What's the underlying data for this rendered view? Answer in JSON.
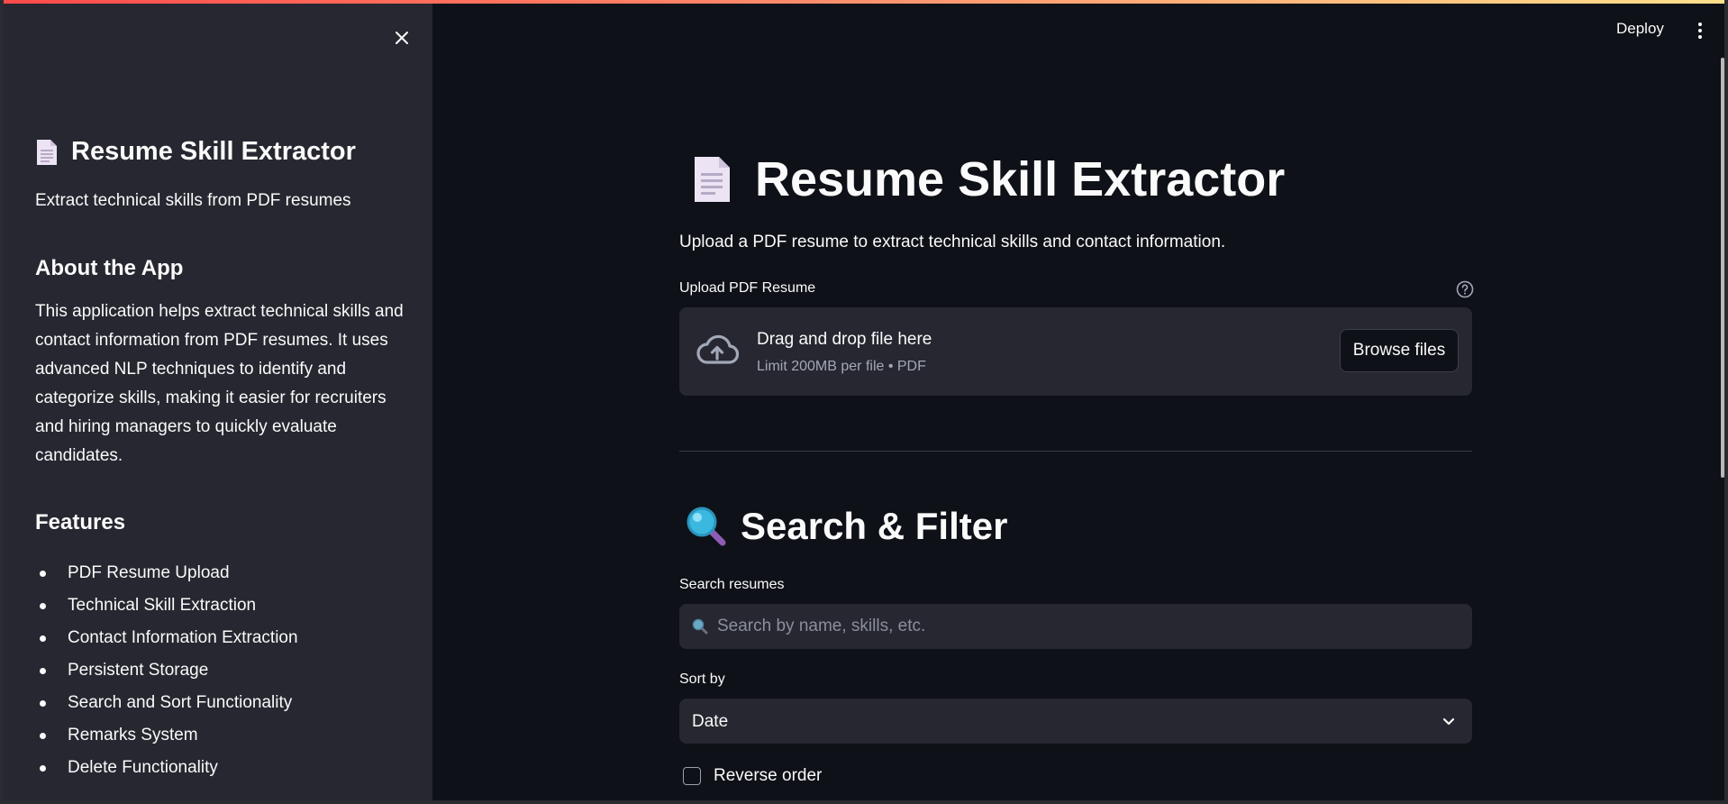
{
  "header": {
    "deploy_label": "Deploy"
  },
  "sidebar": {
    "title": "Resume Skill Extractor",
    "subtitle": "Extract technical skills from PDF resumes",
    "about_heading": "About the App",
    "about_text": "This application helps extract technical skills and contact information from PDF resumes. It uses advanced NLP techniques to identify and categorize skills, making it easier for recruiters and hiring managers to quickly evaluate candidates.",
    "features_heading": "Features",
    "features": [
      "PDF Resume Upload",
      "Technical Skill Extraction",
      "Contact Information Extraction",
      "Persistent Storage",
      "Search and Sort Functionality",
      "Remarks System",
      "Delete Functionality"
    ]
  },
  "main": {
    "title": "Resume Skill Extractor",
    "description": "Upload a PDF resume to extract technical skills and contact information.",
    "uploader": {
      "label": "Upload PDF Resume",
      "drop_text": "Drag and drop file here",
      "limit_text": "Limit 200MB per file • PDF",
      "browse_label": "Browse files"
    },
    "search_section": {
      "title": "Search & Filter",
      "search_label": "Search resumes",
      "search_placeholder": "Search by name, skills, etc.",
      "sort_label": "Sort by",
      "sort_value": "Date",
      "reverse_label": "Reverse order"
    }
  },
  "colors": {
    "background": "#0e1117",
    "sidebar": "#262730",
    "accent": "#ff4b4b",
    "text": "#fafafa"
  },
  "icons": {
    "close": "close-icon",
    "document": "document-icon",
    "help": "help-icon",
    "upload": "cloud-upload-icon",
    "search": "magnifier-icon",
    "chevron": "chevron-down-icon",
    "menu": "kebab-menu-icon"
  }
}
